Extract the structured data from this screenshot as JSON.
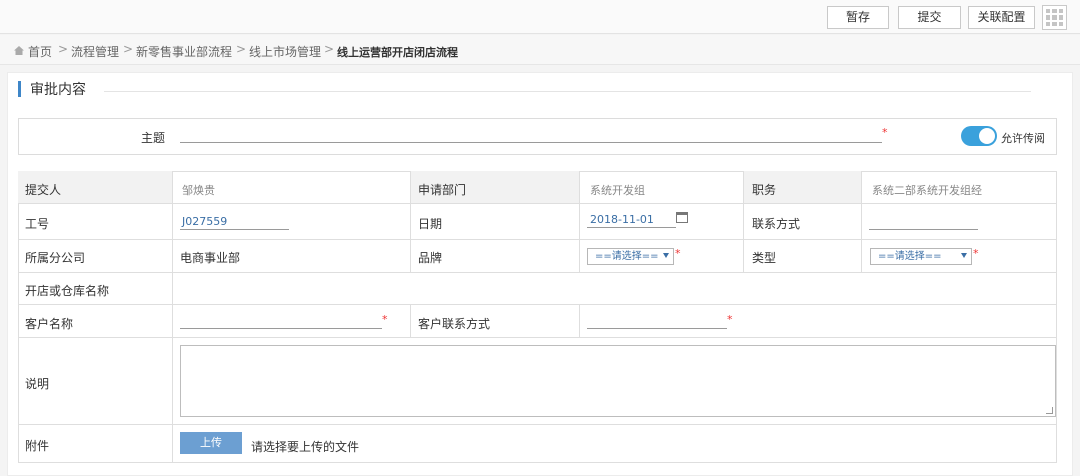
{
  "toolbar": {
    "save_draft": "暂存",
    "submit": "提交",
    "related_config": "关联配置"
  },
  "breadcrumb": [
    "首页",
    "流程管理",
    "新零售事业部流程",
    "线上市场管理",
    "线上运营部开店闭店流程"
  ],
  "breadcrumb_separator": ">",
  "section_title": "审批内容",
  "subject": {
    "label": "主题",
    "value": "",
    "required_mark": "*"
  },
  "allow_read": {
    "label": "允许传阅",
    "on": true
  },
  "form": {
    "submitter_label": "提交人",
    "submitter_value": "邹焕贵",
    "dept_label": "申请部门",
    "dept_value": "系统开发组",
    "position_label": "职务",
    "position_value": "系统二部系统开发组经",
    "id_label": "工号",
    "id_value": "J027559",
    "date_label": "日期",
    "date_value": "2018-11-01",
    "contact_label": "联系方式",
    "contact_value": "",
    "branch_label": "所属分公司",
    "branch_value": "电商事业部",
    "brand_label": "品牌",
    "brand_select": "==请选择==",
    "type_label": "类型",
    "type_select": "==请选择==",
    "store_label": "开店或仓库名称",
    "store_value": "",
    "customer_label": "客户名称",
    "customer_value": "",
    "customer_contact_label": "客户联系方式",
    "customer_contact_value": "",
    "desc_label": "说明",
    "desc_value": "",
    "attach_label": "附件",
    "upload_label": "上传",
    "upload_hint": "请选择要上传的文件",
    "required_mark": "*"
  },
  "colors": {
    "accent": "#3e86c8",
    "toggle_on": "#3aa1dc",
    "upload_button": "#6c9fd2",
    "required": "#e33333",
    "label_bg": "#f2f2f2"
  }
}
